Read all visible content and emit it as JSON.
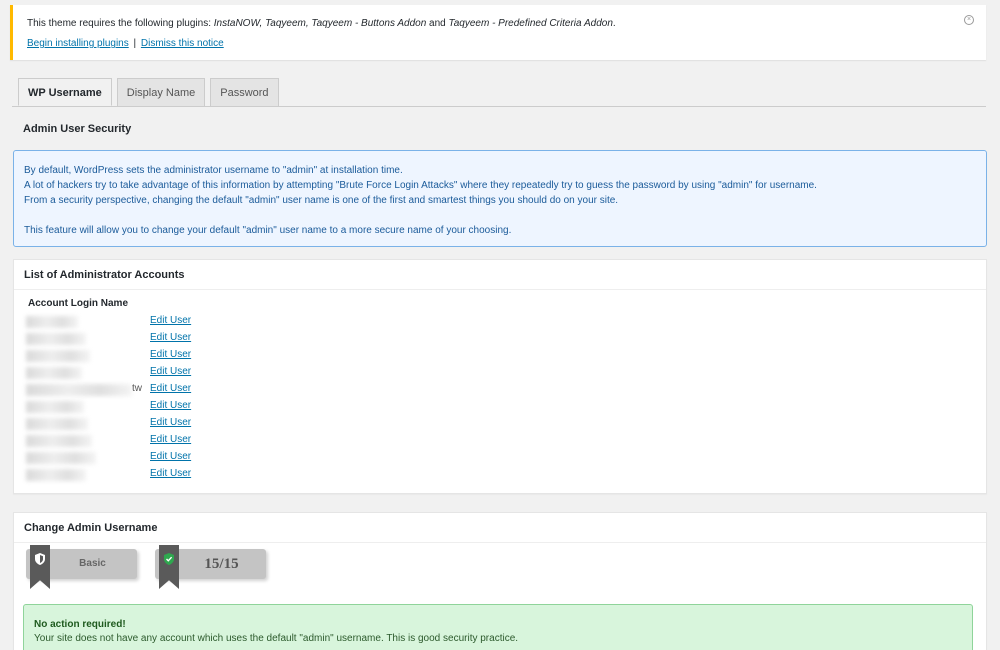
{
  "notice": {
    "text_prefix": "This theme requires the following plugins: ",
    "plugins": "InstaNOW, Taqyeem, Taqyeem - Buttons Addon",
    "and": " and ",
    "plugin_last": "Taqyeem - Predefined Criteria Addon",
    "period": ".",
    "install_link": "Begin installing plugins",
    "separator": "|",
    "dismiss_link": "Dismiss this notice",
    "close_glyph": "×"
  },
  "tabs": [
    {
      "label": "WP Username",
      "active": true
    },
    {
      "label": "Display Name",
      "active": false
    },
    {
      "label": "Password",
      "active": false
    }
  ],
  "section_title": "Admin User Security",
  "info": {
    "line1": "By default, WordPress sets the administrator username to \"admin\" at installation time.",
    "line2": "A lot of hackers try to take advantage of this information by attempting \"Brute Force Login Attacks\" where they repeatedly try to guess the password by using \"admin\" for username.",
    "line3": "From a security perspective, changing the default \"admin\" user name is one of the first and smartest things you should do on your site.",
    "line4": "This feature will allow you to change your default \"admin\" user name to a more secure name of your choosing."
  },
  "accounts": {
    "title": "List of Administrator Accounts",
    "column_header": "Account Login Name",
    "edit_label": "Edit User",
    "rows": [
      {
        "suffix": ""
      },
      {
        "suffix": ""
      },
      {
        "suffix": ""
      },
      {
        "suffix": ""
      },
      {
        "suffix": "tw"
      },
      {
        "suffix": ""
      },
      {
        "suffix": ""
      },
      {
        "suffix": ""
      },
      {
        "suffix": ""
      },
      {
        "suffix": ""
      }
    ]
  },
  "change": {
    "title": "Change Admin Username",
    "badge_basic": "Basic",
    "badge_score": "15/15",
    "success_title": "No action required!",
    "success_text": "Your site does not have any account which uses the default \"admin\" username. This is good security practice."
  },
  "colors": {
    "notice_accent": "#ffb900",
    "link": "#0073aa",
    "info_border": "#7ab2e8",
    "success_bg": "#d8f5dc"
  }
}
